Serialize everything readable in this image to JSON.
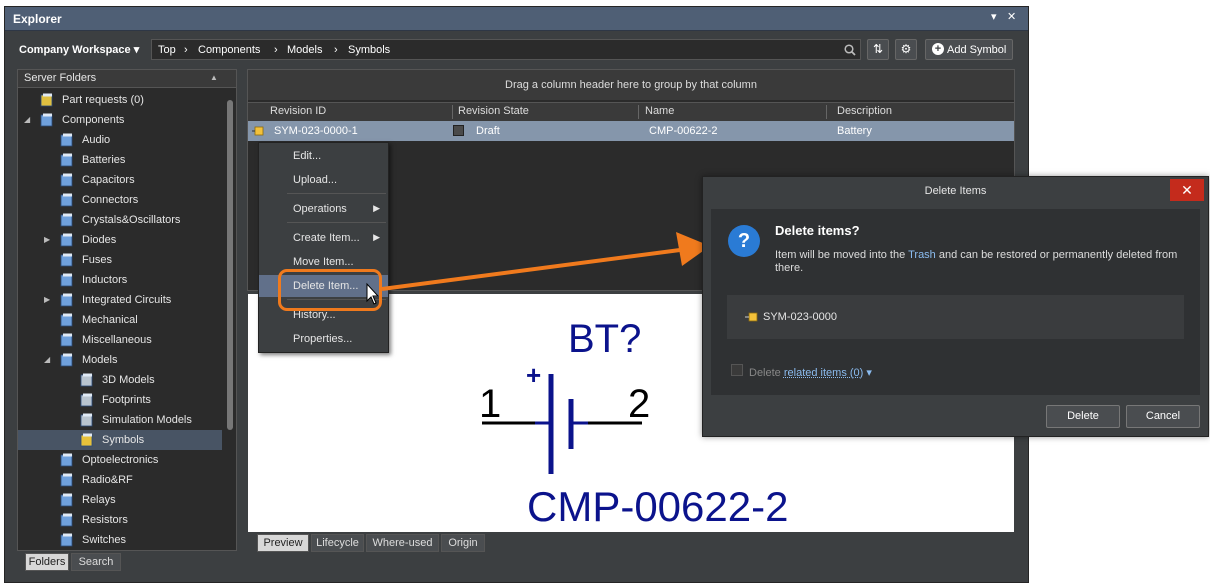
{
  "window": {
    "title": "Explorer",
    "menu_glyph": "▾",
    "close_glyph": "✕"
  },
  "toolbar": {
    "workspace": "Company Workspace",
    "breadcrumb": [
      "Top",
      "Components",
      "Models",
      "Symbols"
    ],
    "add_symbol": "Add Symbol"
  },
  "folders": {
    "header": "Server Folders",
    "items": [
      {
        "label": "Part requests (0)",
        "depth": 0,
        "expander": ""
      },
      {
        "label": "Components",
        "depth": 0,
        "expander": "◢"
      },
      {
        "label": "Audio",
        "depth": 1,
        "expander": ""
      },
      {
        "label": "Batteries",
        "depth": 1,
        "expander": ""
      },
      {
        "label": "Capacitors",
        "depth": 1,
        "expander": ""
      },
      {
        "label": "Connectors",
        "depth": 1,
        "expander": ""
      },
      {
        "label": "Crystals&Oscillators",
        "depth": 1,
        "expander": ""
      },
      {
        "label": "Diodes",
        "depth": 1,
        "expander": "▶"
      },
      {
        "label": "Fuses",
        "depth": 1,
        "expander": ""
      },
      {
        "label": "Inductors",
        "depth": 1,
        "expander": ""
      },
      {
        "label": "Integrated Circuits",
        "depth": 1,
        "expander": "▶"
      },
      {
        "label": "Mechanical",
        "depth": 1,
        "expander": ""
      },
      {
        "label": "Miscellaneous",
        "depth": 1,
        "expander": ""
      },
      {
        "label": "Models",
        "depth": 1,
        "expander": "◢"
      },
      {
        "label": "3D Models",
        "depth": 2,
        "expander": ""
      },
      {
        "label": "Footprints",
        "depth": 2,
        "expander": ""
      },
      {
        "label": "Simulation Models",
        "depth": 2,
        "expander": ""
      },
      {
        "label": "Symbols",
        "depth": 2,
        "expander": "",
        "selected": true
      },
      {
        "label": "Optoelectronics",
        "depth": 1,
        "expander": ""
      },
      {
        "label": "Radio&RF",
        "depth": 1,
        "expander": ""
      },
      {
        "label": "Relays",
        "depth": 1,
        "expander": ""
      },
      {
        "label": "Resistors",
        "depth": 1,
        "expander": ""
      },
      {
        "label": "Switches",
        "depth": 1,
        "expander": ""
      }
    ]
  },
  "left_tabs": [
    "Folders",
    "Search"
  ],
  "grid": {
    "group_hint": "Drag a column header here to group by that column",
    "columns": [
      "Revision ID",
      "Revision State",
      "Name",
      "Description"
    ],
    "row": {
      "revision_id": "SYM-023-0000-1",
      "state": "Draft",
      "name": "CMP-00622-2",
      "description": "Battery"
    }
  },
  "context_menu": [
    {
      "label": "Edit...",
      "submenu": false
    },
    {
      "label": "Upload...",
      "submenu": false
    },
    {
      "label": "Operations",
      "submenu": true
    },
    {
      "label": "Create Item...",
      "submenu": true
    },
    {
      "label": "Move Item...",
      "submenu": false
    },
    {
      "label": "Delete Item...",
      "submenu": false,
      "highlighted": true
    },
    {
      "label": "History...",
      "submenu": false
    },
    {
      "label": "Properties...",
      "submenu": false
    }
  ],
  "preview": {
    "designator": "BT?",
    "plus": "+",
    "pin1": "1",
    "pin2": "2",
    "comment": "CMP-00622-2",
    "color": "#0b138c"
  },
  "preview_tabs": [
    "Preview",
    "Lifecycle",
    "Where-used",
    "Origin"
  ],
  "dialog": {
    "title": "Delete Items",
    "close": "✕",
    "icon": "?",
    "heading": "Delete items?",
    "msg_pre": "Item will be moved into the ",
    "msg_link": "Trash",
    "msg_post": " and can be restored or permanently deleted from there.",
    "item": "SYM-023-0000",
    "check_label": "Delete ",
    "check_link": "related items (0)",
    "check_arrow": "▾",
    "delete_btn": "Delete",
    "cancel_btn": "Cancel"
  },
  "colors": {
    "accent": "#f07a1d",
    "selection": "#8596ab",
    "title_bar": "#4f5f75"
  }
}
